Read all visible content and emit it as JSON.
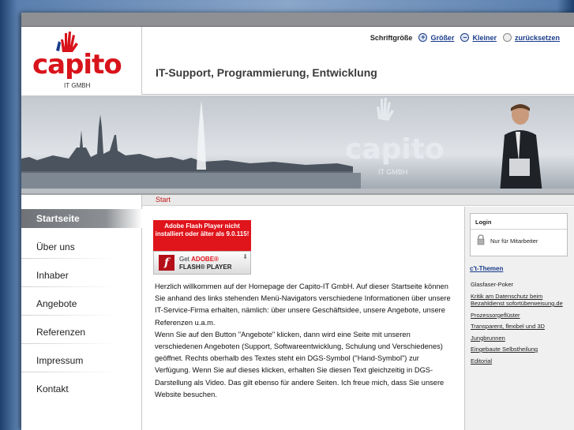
{
  "header": {
    "logo_text": "capito",
    "logo_sub_it": "IT",
    "logo_sub_gmbh": "GMBH",
    "tagline": "IT-Support, Programmierung, Entwicklung",
    "font_size": {
      "label": "Schriftgröße",
      "bigger": "Größer",
      "smaller": "Kleiner",
      "reset": "zurücksetzen"
    }
  },
  "banner": {
    "logo_text": "capito",
    "logo_sub": "IT GMBH"
  },
  "breadcrumb": "Start",
  "nav": {
    "items": [
      {
        "label": "Startseite",
        "active": true
      },
      {
        "label": "Über uns"
      },
      {
        "label": "Inhaber"
      },
      {
        "label": "Angebote"
      },
      {
        "label": "Referenzen"
      },
      {
        "label": "Impressum"
      },
      {
        "label": "Kontakt"
      }
    ]
  },
  "flash": {
    "warning": "Adobe Flash Player nicht installiert oder älter als 9.0.115!",
    "get": "Get",
    "adobe": "ADOBE®",
    "player": "FLASH® PLAYER"
  },
  "content": {
    "paragraph1": "Herzlich willkommen auf der Homepage der Capito-IT GmbH. Auf dieser Startseite können Sie anhand des links stehenden Menü-Navigators verschiedene Informationen über unsere IT-Service-Firma erhalten, nämlich: über unsere Geschäftsidee, unsere Angebote, unsere Referenzen u.a.m.",
    "paragraph2": "Wenn Sie auf den Button \"Angebote\" klicken, dann wird eine Seite mit unseren verschiedenen Angeboten (Support, Softwareentwicklung, Schulung und Verschiedenes) geöffnet. Rechts oberhalb des Textes steht ein DGS-Symbol (\"Hand-Symbol\") zur Verfügung. Wenn Sie auf dieses klicken, erhalten Sie diesen Text gleichzeitig in DGS-Darstellung als Video. Das gilt ebenso für andere Seiten. Ich freue mich, dass Sie unsere Website besuchen."
  },
  "login": {
    "title": "Login",
    "link": "Nur für Mitarbeiter"
  },
  "ct": {
    "title": "c't-Themen",
    "items": [
      {
        "label": "Glasfaser-Poker",
        "underline": false
      },
      {
        "label": "Kritik am Datenschutz beim Bezahldienst sofortüberweisung.de",
        "underline": true
      },
      {
        "label": "Prozessorgeflüster",
        "underline": true
      },
      {
        "label": "Transparent, flexibel und 3D",
        "underline": true
      },
      {
        "label": "Jungbrunnen",
        "underline": true
      },
      {
        "label": "Eingebaute Selbstheilung",
        "underline": true
      },
      {
        "label": "Editorial",
        "underline": true
      }
    ]
  },
  "colors": {
    "brand_red": "#d8131b",
    "link_blue": "#1a3c8a",
    "nav_active": "#7c7f83"
  }
}
